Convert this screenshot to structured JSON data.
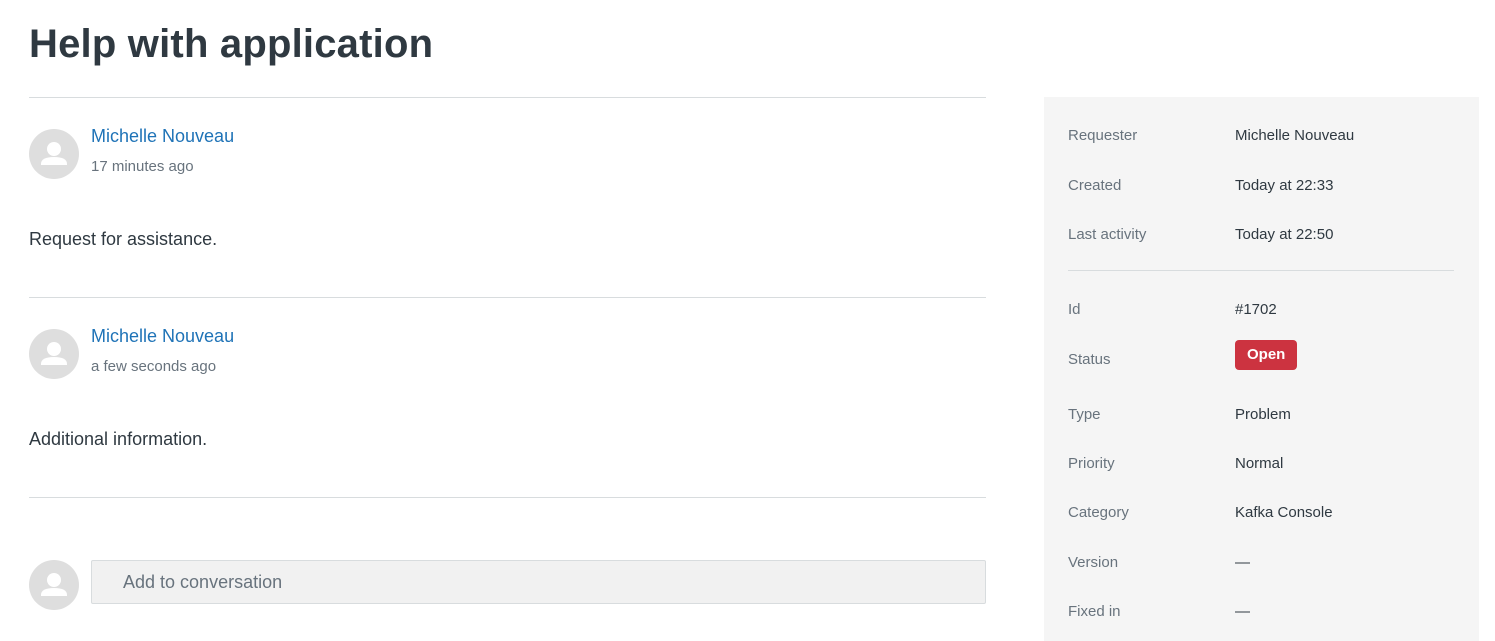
{
  "page": {
    "title": "Help with application"
  },
  "comments": [
    {
      "author": "Michelle Nouveau",
      "time": "17 minutes ago",
      "body": "Request for assistance."
    },
    {
      "author": "Michelle Nouveau",
      "time": "a few seconds ago",
      "body": "Additional information."
    }
  ],
  "composer": {
    "placeholder": "Add to conversation"
  },
  "sidebar": {
    "requester": {
      "label": "Requester",
      "value": "Michelle Nouveau"
    },
    "created": {
      "label": "Created",
      "value": "Today at 22:33"
    },
    "last_activity": {
      "label": "Last activity",
      "value": "Today at 22:50"
    },
    "id": {
      "label": "Id",
      "value": "#1702"
    },
    "status": {
      "label": "Status",
      "value": "Open",
      "color": "#cc3340"
    },
    "type": {
      "label": "Type",
      "value": "Problem"
    },
    "priority": {
      "label": "Priority",
      "value": "Normal"
    },
    "category": {
      "label": "Category",
      "value": "Kafka Console"
    },
    "version": {
      "label": "Version",
      "value": "—"
    },
    "fixed_in": {
      "label": "Fixed in",
      "value": "—"
    }
  },
  "icons": {
    "avatar": "user-avatar-icon"
  },
  "colors": {
    "link": "#1f73b7",
    "status_open": "#cc3340",
    "sidebar_bg": "#f5f5f5"
  }
}
